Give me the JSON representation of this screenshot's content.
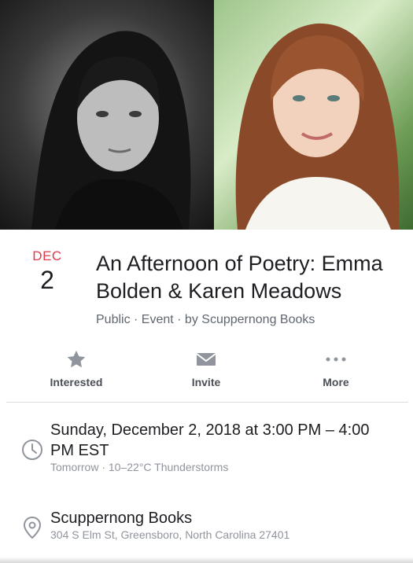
{
  "event": {
    "month": "DEC",
    "day": "2",
    "title": "An Afternoon of Poetry: Emma Bolden & Karen Meadows",
    "meta": "Public · Event · by Scuppernong Books"
  },
  "actions": [
    {
      "label": "Interested",
      "icon": "star-icon"
    },
    {
      "label": "Invite",
      "icon": "envelope-icon"
    },
    {
      "label": "More",
      "icon": "more-dots-icon"
    }
  ],
  "time": {
    "text": "Sunday, December 2, 2018 at 3:00 PM – 4:00 PM EST",
    "sub": "Tomorrow · 10–22°C Thunderstorms",
    "icon": "clock-icon"
  },
  "location": {
    "name": "Scuppernong Books",
    "address": "304 S Elm St, Greensboro, North Carolina 27401",
    "icon": "location-pin-icon"
  },
  "colors": {
    "month": "#e0384b",
    "icon": "#90949c",
    "label": "#4b4f56"
  }
}
